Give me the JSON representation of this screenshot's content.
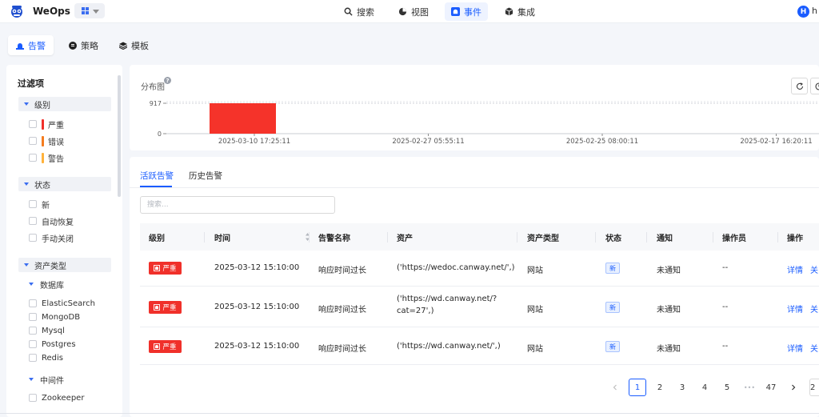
{
  "app": {
    "brand": "WeOps",
    "user_initial": "H",
    "user_name": "h"
  },
  "nav": [
    {
      "label": "搜索",
      "icon": "search-icon"
    },
    {
      "label": "视图",
      "icon": "chart-icon"
    },
    {
      "label": "事件",
      "icon": "alarm-icon",
      "active": true
    },
    {
      "label": "集成",
      "icon": "cube-icon"
    }
  ],
  "subnav": [
    {
      "label": "告警",
      "icon": "alarm-bell-icon",
      "active": true
    },
    {
      "label": "策略",
      "icon": "policy-icon"
    },
    {
      "label": "模板",
      "icon": "layers-icon"
    }
  ],
  "filter": {
    "title": "过滤项",
    "level": {
      "label": "级别",
      "items": [
        {
          "label": "严重",
          "color": "#f0302a"
        },
        {
          "label": "错误",
          "color": "#f57c1f"
        },
        {
          "label": "警告",
          "color": "#ffb23b"
        }
      ]
    },
    "status": {
      "label": "状态",
      "items": [
        "新",
        "自动恢复",
        "手动关闭"
      ]
    },
    "asset_type": {
      "label": "资产类型",
      "database": {
        "label": "数据库",
        "items": [
          "ElasticSearch",
          "MongoDB",
          "Mysql",
          "Postgres",
          "Redis"
        ]
      },
      "middleware": {
        "label": "中间件",
        "items": [
          "Zookeeper"
        ]
      }
    }
  },
  "chart": {
    "title": "分布图",
    "help": "?"
  },
  "chart_data": {
    "type": "bar",
    "categories": [
      "2025-03-10 17:25:11",
      "2025-02-27 05:55:11",
      "2025-02-25 08:00:11",
      "2025-02-17 16:20:11"
    ],
    "values": [
      917,
      0,
      0,
      0
    ],
    "yticks": [
      0,
      917
    ],
    "ylim": [
      0,
      917
    ],
    "bar_color": "#f5332a"
  },
  "tabs": {
    "active": "活跃告警",
    "history": "历史告警"
  },
  "search": {
    "placeholder": "搜索..."
  },
  "table": {
    "columns": [
      "级别",
      "时间",
      "告警名称",
      "资产",
      "资产类型",
      "状态",
      "通知",
      "操作员",
      "操作"
    ],
    "rows": [
      {
        "level": "严重",
        "time": "2025-03-12 15:10:00",
        "name": "响应时间过长",
        "asset": "('https://wedoc.canway.net/',)",
        "asset_type": "网站",
        "status": "新",
        "notify": "未通知",
        "operator": "--",
        "action_detail": "详情",
        "action_close": "关"
      },
      {
        "level": "严重",
        "time": "2025-03-12 15:10:00",
        "name": "响应时间过长",
        "asset": "('https://wd.canway.net/?cat=27',)",
        "asset_line1": "('https://wd.canway.net/?",
        "asset_line2": "cat=27',)",
        "asset_type": "网站",
        "status": "新",
        "notify": "未通知",
        "operator": "--",
        "action_detail": "详情",
        "action_close": "关"
      },
      {
        "level": "严重",
        "time": "2025-03-12 15:10:00",
        "name": "响应时间过长",
        "asset": "('https://wd.canway.net/',)",
        "asset_type": "网站",
        "status": "新",
        "notify": "未通知",
        "operator": "--",
        "action_detail": "详情",
        "action_close": "关"
      }
    ]
  },
  "pagination": {
    "pages": [
      "1",
      "2",
      "3",
      "4",
      "5"
    ],
    "ellipsis": "•••",
    "last": "47",
    "current": "1",
    "next_partial": "2"
  },
  "colors": {
    "accent": "#1a5cff",
    "severe": "#f0302a"
  }
}
